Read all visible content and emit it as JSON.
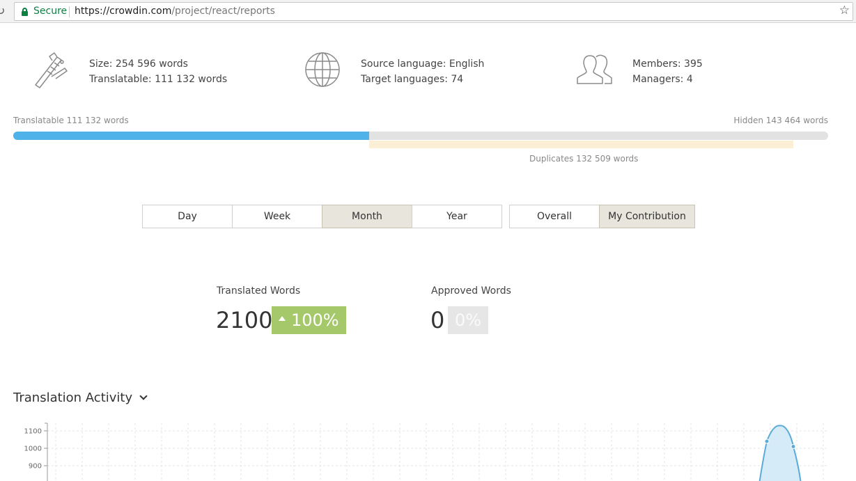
{
  "browser": {
    "secure_label": "Secure",
    "url_host": "https://crowdin.com",
    "url_path": "/project/react/reports"
  },
  "stats": {
    "size": "Size: 254 596 words",
    "translatable": "Translatable: 111 132 words",
    "source_language": "Source language: English",
    "target_languages": "Target languages: 74",
    "members": "Members: 395",
    "managers": "Managers: 4"
  },
  "progress": {
    "translatable_label": "Translatable 111 132 words",
    "hidden_label": "Hidden 143 464 words",
    "duplicates_label": "Duplicates 132 509 words",
    "total_words": 254596,
    "translatable_words": 111132,
    "duplicates_words": 132509,
    "fill_color": "#4fb3ea",
    "duplicates_color": "#fbefd6"
  },
  "periods": [
    {
      "label": "Day",
      "active": false
    },
    {
      "label": "Week",
      "active": false
    },
    {
      "label": "Month",
      "active": true
    },
    {
      "label": "Year",
      "active": false
    }
  ],
  "scope": [
    {
      "label": "Overall",
      "active": false
    },
    {
      "label": "My Contribution",
      "active": true
    }
  ],
  "metrics": {
    "translated_label": "Translated Words",
    "translated_value": "2100",
    "translated_change": "100%",
    "approved_label": "Approved Words",
    "approved_value": "0",
    "approved_change": "0%",
    "positive_color": "#a5c96a"
  },
  "activity": {
    "title": "Translation Activity"
  },
  "chart_data": {
    "type": "area",
    "y_ticks": [
      "1100",
      "1000",
      "900"
    ],
    "series": [
      {
        "values": [
          1040,
          1130,
          1010
        ]
      }
    ],
    "color": "#5aabd6",
    "grid": true
  },
  "icons": {
    "calipers": "calipers-icon",
    "globe": "globe-icon",
    "members": "members-icon",
    "star": "star-icon",
    "lock": "lock-icon",
    "reload": "reload-icon"
  }
}
